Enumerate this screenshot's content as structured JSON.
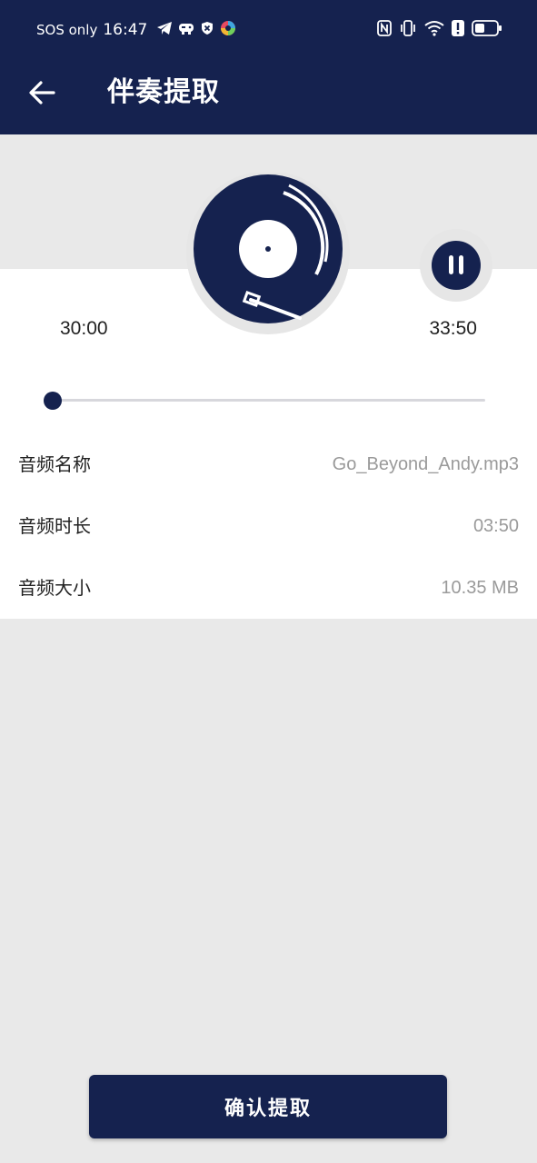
{
  "status_bar": {
    "carrier": "SOS only",
    "time": "16:47",
    "icons_left": [
      "telegram-icon",
      "game-controller-icon",
      "shield-icon",
      "colorful-app-icon"
    ],
    "icons_right": [
      "nfc-icon",
      "vibrate-icon",
      "wifi-icon",
      "alert-icon",
      "battery-icon"
    ]
  },
  "header": {
    "title": "伴奏提取",
    "back_icon": "arrow-left-icon"
  },
  "player": {
    "current_time": "30:00",
    "total_time": "33:50",
    "progress": 0.0,
    "state_icon": "pause-icon",
    "disc_icon": "vinyl-record-icon"
  },
  "details": [
    {
      "label": "音频名称",
      "value": "Go_Beyond_Andy.mp3"
    },
    {
      "label": "音频时长",
      "value": "03:50"
    },
    {
      "label": "音频大小",
      "value": "10.35 MB"
    }
  ],
  "confirm_label": "确认提取",
  "colors": {
    "primary": "#15224f",
    "background": "#e9e9e9",
    "panel": "#ffffff",
    "secondary_text": "#9a9a9a"
  }
}
